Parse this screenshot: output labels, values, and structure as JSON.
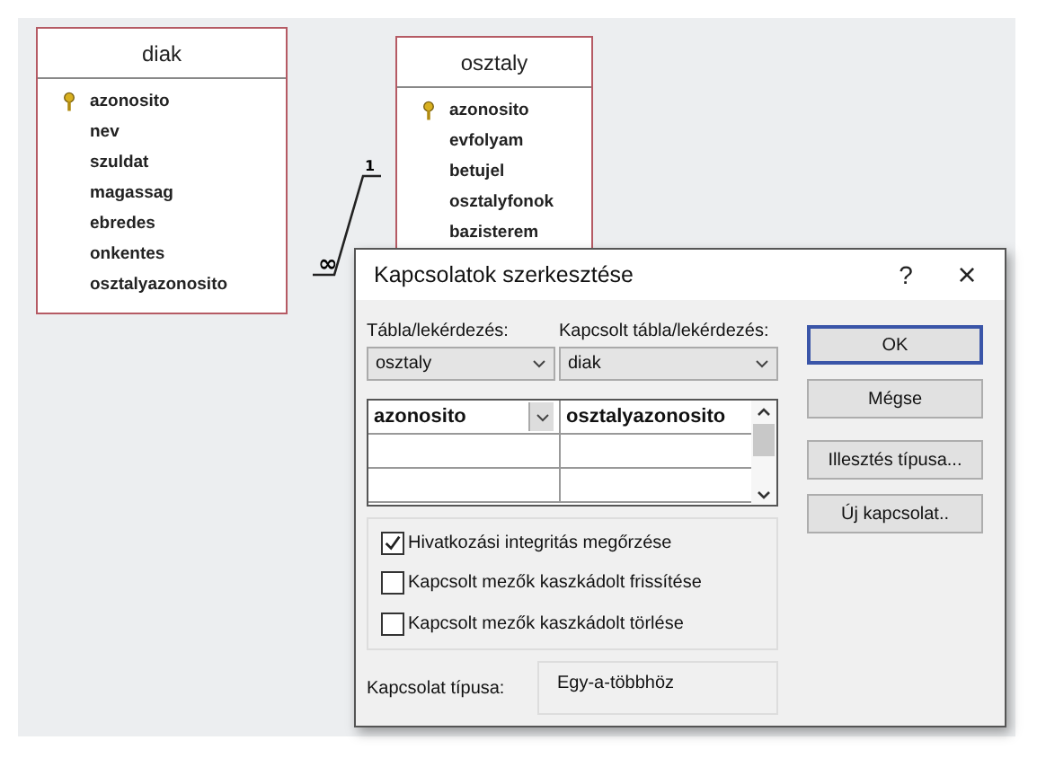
{
  "tables": [
    {
      "name": "diak",
      "fields": [
        {
          "name": "azonosito",
          "primary_key": true
        },
        {
          "name": "nev",
          "primary_key": false
        },
        {
          "name": "szuldat",
          "primary_key": false
        },
        {
          "name": "magassag",
          "primary_key": false
        },
        {
          "name": "ebredes",
          "primary_key": false
        },
        {
          "name": "onkentes",
          "primary_key": false
        },
        {
          "name": "osztalyazonosito",
          "primary_key": false
        }
      ]
    },
    {
      "name": "osztaly",
      "fields": [
        {
          "name": "azonosito",
          "primary_key": true
        },
        {
          "name": "evfolyam",
          "primary_key": false
        },
        {
          "name": "betujel",
          "primary_key": false
        },
        {
          "name": "osztalyfonok",
          "primary_key": false
        },
        {
          "name": "bazisterem",
          "primary_key": false
        }
      ]
    }
  ],
  "relationship": {
    "one_label": "1",
    "many_label": "∞"
  },
  "dialog": {
    "title": "Kapcsolatok szerkesztése",
    "help": "?",
    "close": "×",
    "table_label": "Tábla/lekérdezés:",
    "table_value": "osztaly",
    "related_label": "Kapcsolt tábla/lekérdezés:",
    "related_value": "diak",
    "field_rows": [
      {
        "left": "azonosito",
        "right": "osztalyazonosito"
      }
    ],
    "options": [
      {
        "label": "Hivatkozási integritás megőrzése",
        "checked": true
      },
      {
        "label": "Kapcsolt mezők kaszkádolt frissítése",
        "checked": false
      },
      {
        "label": "Kapcsolt mezők kaszkádolt törlése",
        "checked": false
      }
    ],
    "type_label": "Kapcsolat típusa:",
    "type_value": "Egy-a-többhöz",
    "buttons": [
      {
        "label": "OK",
        "default": true
      },
      {
        "label": "Mégse",
        "default": false
      },
      {
        "label": "Illesztés típusa...",
        "default": false
      },
      {
        "label": "Új kapcsolat..",
        "default": false
      }
    ]
  }
}
